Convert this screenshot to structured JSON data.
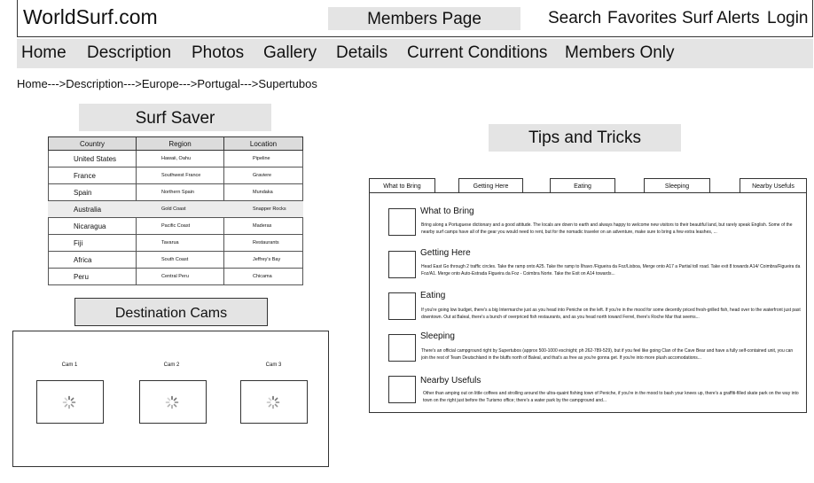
{
  "site": {
    "logo": "WorldSurf.com",
    "page_label": "Members Page",
    "top_links": [
      "Search",
      "Favorites",
      "Surf Alerts",
      "Login"
    ]
  },
  "nav": {
    "items": [
      "Home",
      "Description",
      "Photos",
      "Gallery",
      "Details",
      "Current Conditions",
      "Members Only"
    ]
  },
  "breadcrumb": "Home--->Description--->Europe--->Portugal--->Supertubos",
  "surf_saver": {
    "title": "Surf Saver",
    "columns": [
      "Country",
      "Region",
      "Location"
    ],
    "rows": [
      {
        "country": "United States",
        "region": "Hawaii, Oahu",
        "location": "Pipeline"
      },
      {
        "country": "France",
        "region": "Southwest France",
        "location": "Graviere"
      },
      {
        "country": "Spain",
        "region": "Northern Spain",
        "location": "Mundaka"
      },
      {
        "country": "Australia",
        "region": "Gold Coast",
        "location": "Snapper Rocks"
      },
      {
        "country": "Nicaragua",
        "region": "Pacific Coast",
        "location": "Maderas"
      },
      {
        "country": "Fiji",
        "region": "Tavarua",
        "location": "Restaurants"
      },
      {
        "country": "Africa",
        "region": "South Coast",
        "location": "Jeffrey's Bay"
      },
      {
        "country": "Peru",
        "region": "Central Peru",
        "location": "Chicama"
      }
    ]
  },
  "destination_cams": {
    "title": "Destination Cams",
    "cams": [
      "Cam 1",
      "Cam 2",
      "Cam 3"
    ]
  },
  "tips": {
    "title": "Tips and Tricks",
    "tabs": [
      "What to Bring",
      "Getting Here",
      "Eating",
      "Sleeping",
      "Nearby Usefuls"
    ],
    "items": [
      {
        "title": "What to Bring",
        "text": "Bring along a Portuguese dictionary and a good attitude. The locals are down to earth and always happy to welcome new visitors to their beautiful land, but rarely speak English.  Some of the nearby surf camps have all of the gear you would need to rent, but for the nomadic traveler on an adventure, make sure to bring a few extra leashes, ..."
      },
      {
        "title": "Getting Here",
        "text": "Head East Go through 2 traffic circles. Take the ramp onto A25. Take the ramp to Ílhavo /Figueira da Foz/Lisboa, Merge onto A17 a Partial toll road. Take exit 8 towards A14/ Coimbra/Figueira da Foz/A1.  Merge onto Auto-Estrada Figueira da Foz - Coimbra Norte. Take the Exit on A14 towards..."
      },
      {
        "title": "Eating",
        "text": "If you're going low budget, there's a big Intermarche just as you head into Peniche on the left.  If you're in the mood for some decently priced fresh-grilled fish, head over to the waterfront just past downtown.  Out at Baleal, there's a bunch of overpriced fish restaurants, and as you head north toward Ferrel, there's Roche Mar that seems..."
      },
      {
        "title": "Sleeping",
        "text": "There's an official campground right by Supertubos (approx 500-1000 esc/night; ph 262-789-529), but if you feel like going Clan of the Cave Bear and have a fully self-contained unit, you can join the rest of Team Deutschland in the bluffs north of Baleal, and that's as free as you're gonna get.  If you're into more plush accomodations..."
      },
      {
        "title": "Nearby Usefuls",
        "text": "Other than amping out on little coffees and strolling around the ultra-quaint fishing town of Peniche, if you're in the mood to bash your knees up, there's a graffiti-filled skate park on the way into town on the right just before the Turismo office; there's a water park by the campground and..."
      }
    ]
  }
}
